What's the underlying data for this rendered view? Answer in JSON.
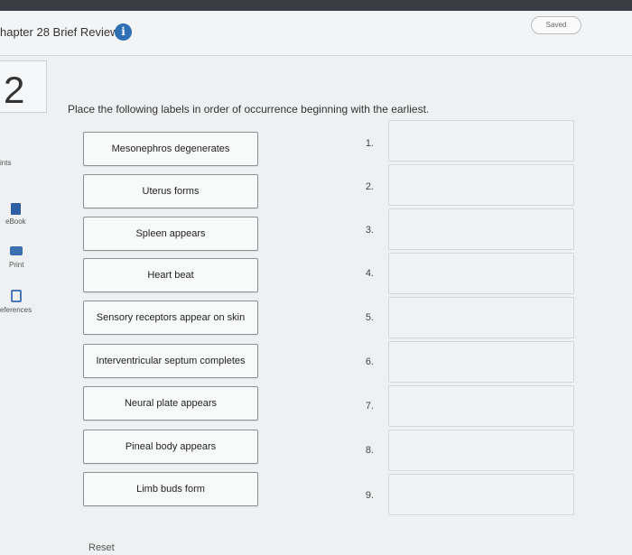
{
  "header": {
    "title": "hapter 28 Brief Review",
    "info_icon": "i",
    "saved_label": "Saved"
  },
  "sidebar": {
    "question_number": "2",
    "points_label": "ints",
    "ebook_label": "eBook",
    "print_label": "Print",
    "references_label": "eferences"
  },
  "question": {
    "prompt": "Place the following labels in order of occurrence beginning with the earliest.",
    "labels": [
      "Mesonephros degenerates",
      "Uterus forms",
      "Spleen appears",
      "Heart beat",
      "Sensory receptors appear on skin",
      "Interventricular septum completes",
      "Neural plate appears",
      "Pineal body appears",
      "Limb buds form"
    ],
    "slot_numbers": [
      "1.",
      "2.",
      "3.",
      "4.",
      "5.",
      "6.",
      "7.",
      "8.",
      "9."
    ]
  },
  "footer": {
    "reset_label": "Reset"
  },
  "colors": {
    "accent": "#2f6fb5",
    "top_bar": "#3a3d44"
  }
}
